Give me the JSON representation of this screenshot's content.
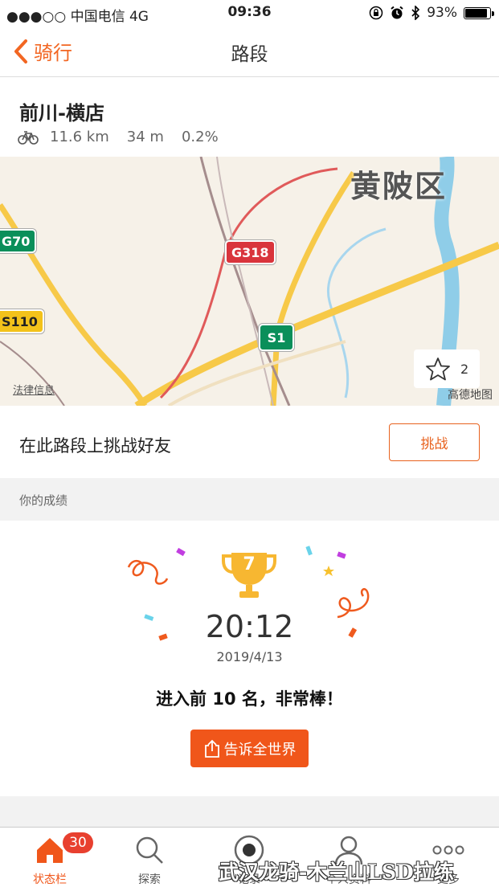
{
  "status_bar": {
    "carrier": "●●●○○ 中国电信   4G",
    "time": "09:36",
    "battery": "93%"
  },
  "nav": {
    "back_label": "骑行",
    "title": "路段"
  },
  "segment": {
    "name": "前川-横店",
    "distance": "11.6 km",
    "elevation": "34 m",
    "grade": "0.2%"
  },
  "map": {
    "district": "黄陂区",
    "badges": {
      "g70": "G70",
      "g318": "G318",
      "s1": "S1",
      "s110": "S110"
    },
    "legal": "法律信息",
    "brand": "高德地图",
    "star_count": "2"
  },
  "challenge": {
    "text": "在此路段上挑战好友",
    "button": "挑战"
  },
  "section": {
    "label": "你的成绩"
  },
  "result": {
    "rank": "7",
    "time": "20:12",
    "date": "2019/4/13",
    "message": "进入前 10 名，非常棒！",
    "share_button": "告诉全世界"
  },
  "tabs": [
    {
      "label": "状态栏",
      "icon": "home-icon",
      "badge": "30"
    },
    {
      "label": "探索",
      "icon": "search-icon"
    },
    {
      "label": "记录",
      "icon": "record-icon"
    },
    {
      "label": "个人资料",
      "icon": "profile-icon"
    },
    {
      "label": "更多",
      "icon": "more-icon"
    }
  ],
  "watermark": "武汉龙骑-木兰山LSD拉练",
  "colors": {
    "accent": "#f26622",
    "button": "#f0561a",
    "trophy": "#f7b731",
    "badge": "#e8402f"
  }
}
